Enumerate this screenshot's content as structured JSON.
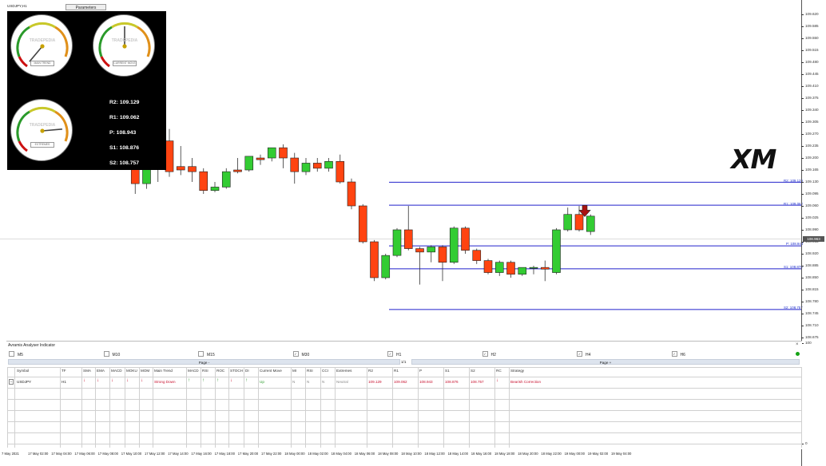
{
  "symbol_label": "USDJPY,H1",
  "parameters_button": "Parameters",
  "current_price_tag": "108.963",
  "price_ticks": [
    "109.620",
    "109.585",
    "109.550",
    "109.515",
    "109.480",
    "109.445",
    "109.410",
    "109.375",
    "109.340",
    "109.305",
    "109.270",
    "109.235",
    "109.200",
    "109.165",
    "109.130",
    "109.095",
    "109.060",
    "109.025",
    "108.990",
    "108.955",
    "108.920",
    "108.885",
    "108.850",
    "108.815",
    "108.780",
    "108.745",
    "108.710",
    "108.675",
    "0",
    "100"
  ],
  "time_ticks": [
    "7 May 2021",
    "17 May 02:00",
    "17 May 04:00",
    "17 May 06:00",
    "17 May 08:00",
    "17 May 10:00",
    "17 May 12:00",
    "17 May 14:00",
    "17 May 16:00",
    "17 May 18:00",
    "17 May 20:00",
    "17 May 22:00",
    "18 May 00:00",
    "18 May 02:00",
    "18 May 04:00",
    "18 May 06:00",
    "18 May 08:00",
    "18 May 10:00",
    "18 May 12:00",
    "18 May 14:00",
    "18 May 16:00",
    "18 May 18:00",
    "18 May 20:00",
    "18 May 22:00",
    "19 May 00:00",
    "19 May 02:00",
    "19 May 04:00"
  ],
  "pivot_levels": {
    "r2": {
      "label": "R2: 109.129",
      "value": 109.129
    },
    "r1": {
      "label": "R1: 109.062",
      "value": 109.062
    },
    "p": {
      "label": "P: 108.943",
      "value": 108.943
    },
    "s1": {
      "label": "S1: 108.876",
      "value": 108.876
    },
    "s2": {
      "label": "S2: 108.757",
      "value": 108.757
    }
  },
  "gauges_panel": {
    "brand": "TRADEPEDIA",
    "gauge_captions": [
      "MAIN TREND",
      "CURRENT MOVE",
      "EXTREMES"
    ],
    "gauge_needle_angles_deg": [
      -140,
      0,
      85
    ],
    "pivot_lines": [
      "R2: 109.129",
      "R1: 109.062",
      "P:   108.943",
      "S1: 108.876",
      "S2: 108.757"
    ]
  },
  "xm_logo_text": "XM",
  "candles": [
    {
      "o": 109.2,
      "h": 109.23,
      "c": 109.185,
      "l": 109.165,
      "bull": false
    },
    {
      "o": 109.18,
      "h": 109.21,
      "c": 109.125,
      "l": 109.095,
      "bull": false
    },
    {
      "o": 109.125,
      "h": 109.195,
      "c": 109.19,
      "l": 109.11,
      "bull": true
    },
    {
      "o": 109.19,
      "h": 109.255,
      "c": 109.25,
      "l": 109.13,
      "bull": true
    },
    {
      "o": 109.25,
      "h": 109.285,
      "c": 109.16,
      "l": 109.145,
      "bull": false
    },
    {
      "o": 109.165,
      "h": 109.235,
      "c": 109.175,
      "l": 109.15,
      "bull": false
    },
    {
      "o": 109.175,
      "h": 109.2,
      "c": 109.16,
      "l": 109.13,
      "bull": false
    },
    {
      "o": 109.16,
      "h": 109.17,
      "c": 109.105,
      "l": 109.095,
      "bull": false
    },
    {
      "o": 109.105,
      "h": 109.13,
      "c": 109.115,
      "l": 109.1,
      "bull": true
    },
    {
      "o": 109.115,
      "h": 109.17,
      "c": 109.16,
      "l": 109.11,
      "bull": true
    },
    {
      "o": 109.16,
      "h": 109.2,
      "c": 109.165,
      "l": 109.155,
      "bull": false
    },
    {
      "o": 109.165,
      "h": 109.205,
      "c": 109.205,
      "l": 109.16,
      "bull": true
    },
    {
      "o": 109.195,
      "h": 109.21,
      "c": 109.2,
      "l": 109.18,
      "bull": false
    },
    {
      "o": 109.2,
      "h": 109.23,
      "c": 109.23,
      "l": 109.19,
      "bull": true
    },
    {
      "o": 109.23,
      "h": 109.24,
      "c": 109.2,
      "l": 109.17,
      "bull": false
    },
    {
      "o": 109.2,
      "h": 109.215,
      "c": 109.16,
      "l": 109.125,
      "bull": false
    },
    {
      "o": 109.16,
      "h": 109.2,
      "c": 109.185,
      "l": 109.15,
      "bull": true
    },
    {
      "o": 109.185,
      "h": 109.2,
      "c": 109.17,
      "l": 109.16,
      "bull": false
    },
    {
      "o": 109.17,
      "h": 109.2,
      "c": 109.19,
      "l": 109.16,
      "bull": true
    },
    {
      "o": 109.19,
      "h": 109.21,
      "c": 109.13,
      "l": 109.125,
      "bull": false
    },
    {
      "o": 109.13,
      "h": 109.14,
      "c": 109.06,
      "l": 109.05,
      "bull": false
    },
    {
      "o": 109.06,
      "h": 109.065,
      "c": 108.955,
      "l": 108.95,
      "bull": false
    },
    {
      "o": 108.955,
      "h": 108.96,
      "c": 108.85,
      "l": 108.84,
      "bull": false
    },
    {
      "o": 108.85,
      "h": 108.92,
      "c": 108.915,
      "l": 108.845,
      "bull": true
    },
    {
      "o": 108.915,
      "h": 108.995,
      "c": 108.99,
      "l": 108.91,
      "bull": true
    },
    {
      "o": 108.99,
      "h": 109.06,
      "c": 108.935,
      "l": 108.93,
      "bull": false
    },
    {
      "o": 108.935,
      "h": 108.94,
      "c": 108.925,
      "l": 108.83,
      "bull": false
    },
    {
      "o": 108.925,
      "h": 108.945,
      "c": 108.94,
      "l": 108.895,
      "bull": true
    },
    {
      "o": 108.94,
      "h": 108.945,
      "c": 108.895,
      "l": 108.84,
      "bull": false
    },
    {
      "o": 108.895,
      "h": 109.0,
      "c": 108.995,
      "l": 108.89,
      "bull": true
    },
    {
      "o": 108.995,
      "h": 109.0,
      "c": 108.93,
      "l": 108.92,
      "bull": false
    },
    {
      "o": 108.93,
      "h": 108.935,
      "c": 108.9,
      "l": 108.89,
      "bull": false
    },
    {
      "o": 108.9,
      "h": 108.905,
      "c": 108.865,
      "l": 108.86,
      "bull": false
    },
    {
      "o": 108.865,
      "h": 108.9,
      "c": 108.895,
      "l": 108.855,
      "bull": true
    },
    {
      "o": 108.895,
      "h": 108.9,
      "c": 108.86,
      "l": 108.85,
      "bull": false
    },
    {
      "o": 108.86,
      "h": 108.88,
      "c": 108.88,
      "l": 108.855,
      "bull": true
    },
    {
      "o": 108.88,
      "h": 108.885,
      "c": 108.88,
      "l": 108.86,
      "bull": true
    },
    {
      "o": 108.88,
      "h": 108.9,
      "c": 108.875,
      "l": 108.84,
      "bull": false
    },
    {
      "o": 108.865,
      "h": 108.995,
      "c": 108.99,
      "l": 108.86,
      "bull": true
    },
    {
      "o": 108.99,
      "h": 109.055,
      "c": 109.035,
      "l": 108.985,
      "bull": true
    },
    {
      "o": 109.035,
      "h": 109.06,
      "c": 108.99,
      "l": 108.985,
      "bull": false
    },
    {
      "o": 108.985,
      "h": 109.035,
      "c": 109.03,
      "l": 108.975,
      "bull": true
    }
  ],
  "analyser": {
    "title": "Avramis Analyser Indicator",
    "close_label": "×",
    "timeframes": [
      {
        "label": "M5",
        "checked": false
      },
      {
        "label": "M10",
        "checked": false
      },
      {
        "label": "M15",
        "checked": false
      },
      {
        "label": "M30",
        "checked": true
      },
      {
        "label": "H1",
        "checked": true
      },
      {
        "label": "H2",
        "checked": true
      },
      {
        "label": "H4",
        "checked": true
      },
      {
        "label": "H6",
        "checked": true
      }
    ],
    "page_prev": "Page -",
    "page_indicator": "1/1",
    "page_next": "Page +",
    "headers": [
      "Symbol",
      "TF",
      "SMA",
      "EMA",
      "MACD",
      "MOKU",
      "MOM",
      "Main Trend",
      "MACD",
      "RSI",
      "ROC",
      "STOCH",
      "DI",
      "Current Move",
      "MI",
      "RSI",
      "CCI",
      "Extremes",
      "R2",
      "R1",
      "P",
      "S1",
      "S2",
      "RC",
      "Strategy"
    ],
    "row": {
      "expand_icon": "−",
      "symbol": "USDJPY",
      "tf": "H1",
      "sma": "↓",
      "ema": "↓",
      "macd": "↓",
      "moku": "↓",
      "mom": "↓",
      "main_trend": "Strong Down",
      "macd2": "↑",
      "rsi": "↑",
      "roc": "↑",
      "stoch": "↓",
      "di": "↑",
      "current_move": "Up",
      "mi": "N",
      "rsi2": "N",
      "cci": "N",
      "extremes": "Neutral",
      "r2": "109.129",
      "r1": "109.062",
      "p": "108.943",
      "s1": "108.876",
      "s2": "108.757",
      "rc": "↓",
      "strategy": "Bearish Correction"
    }
  },
  "colors": {
    "bull": "#33cc33",
    "bear": "#ff4411",
    "level_line": "#2222cc",
    "down_arrow": "#aa1111",
    "brand_gray": "#c8c8c8"
  }
}
